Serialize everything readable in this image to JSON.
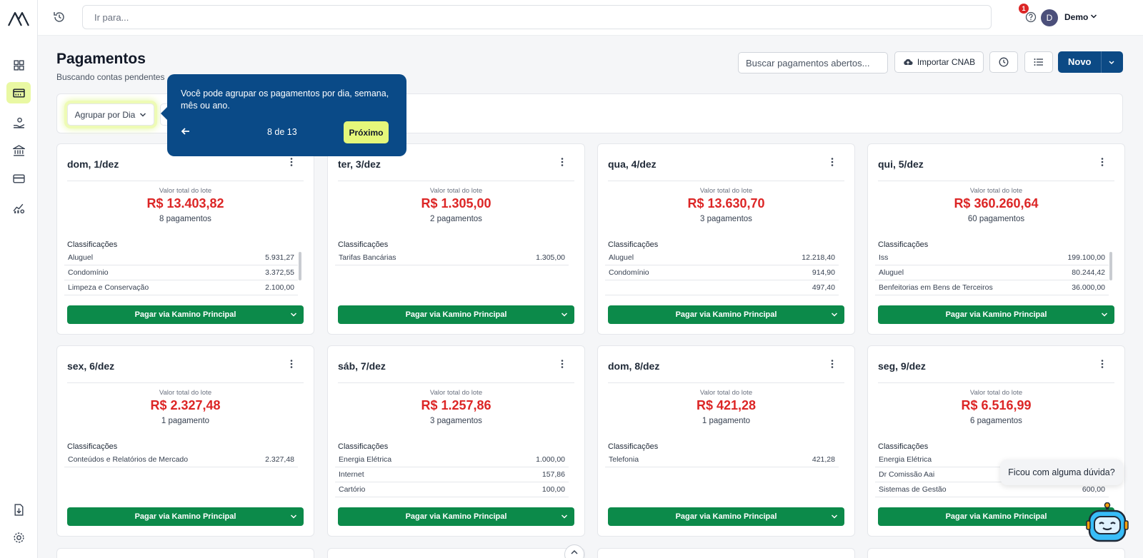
{
  "topbar": {
    "search_placeholder": "Ir para...",
    "notification_count": "1",
    "user_initial": "D",
    "user_name": "Demo"
  },
  "sidebar": {
    "items": [
      "dashboard",
      "payments",
      "receivables",
      "bank",
      "cards",
      "reports",
      "import",
      "settings"
    ],
    "active": "payments",
    "accent_color": "#e9f8a3"
  },
  "header": {
    "title": "Pagamentos",
    "subtitle": "Buscando contas pendentes c",
    "search_placeholder": "Buscar pagamentos abertos...",
    "import_label": "Importar CNAB",
    "new_label": "Novo"
  },
  "filters": {
    "group_label": "Agrupar por Dia"
  },
  "tour": {
    "text": "Você pode agrupar os pagamentos por dia, semana, mês ou ano.",
    "counter": "8 de 13",
    "next_label": "Próximo"
  },
  "card_labels": {
    "total_label": "Valor total do lote",
    "class_title": "Classificações",
    "pay_label": "Pagar via Kamino Principal"
  },
  "cards": [
    {
      "date": "dom, 1/dez",
      "total": "R$ 13.403,82",
      "count": "8 pagamentos",
      "rows": [
        {
          "name": "Aluguel",
          "value": "5.931,27"
        },
        {
          "name": "Condomínio",
          "value": "3.372,55"
        },
        {
          "name": "Limpeza e Conservação",
          "value": "2.100,00"
        }
      ]
    },
    {
      "date": "ter, 3/dez",
      "total": "R$ 1.305,00",
      "count": "2 pagamentos",
      "rows": [
        {
          "name": "Tarifas Bancárias",
          "value": "1.305,00"
        }
      ]
    },
    {
      "date": "qua, 4/dez",
      "total": "R$ 13.630,70",
      "count": "3 pagamentos",
      "rows": [
        {
          "name": "Aluguel",
          "value": "12.218,40"
        },
        {
          "name": "Condomínio",
          "value": "914,90"
        },
        {
          "name": "",
          "value": "497,40"
        }
      ]
    },
    {
      "date": "qui, 5/dez",
      "total": "R$ 360.260,64",
      "count": "60 pagamentos",
      "rows": [
        {
          "name": "Iss",
          "value": "199.100,00"
        },
        {
          "name": "Aluguel",
          "value": "80.244,42"
        },
        {
          "name": "Benfeitorias em Bens de Terceiros",
          "value": "36.000,00"
        }
      ]
    },
    {
      "date": "sex, 6/dez",
      "total": "R$ 2.327,48",
      "count": "1 pagamento",
      "rows": [
        {
          "name": "Conteúdos e Relatórios de Mercado",
          "value": "2.327,48"
        }
      ]
    },
    {
      "date": "sáb, 7/dez",
      "total": "R$ 1.257,86",
      "count": "3 pagamentos",
      "rows": [
        {
          "name": "Energia Elétrica",
          "value": "1.000,00"
        },
        {
          "name": "Internet",
          "value": "157,86"
        },
        {
          "name": "Cartório",
          "value": "100,00"
        }
      ]
    },
    {
      "date": "dom, 8/dez",
      "total": "R$ 421,28",
      "count": "1 pagamento",
      "rows": [
        {
          "name": "Telefonia",
          "value": "421,28"
        }
      ]
    },
    {
      "date": "seg, 9/dez",
      "total": "R$ 6.516,99",
      "count": "6 pagamentos",
      "rows": [
        {
          "name": "Energia Elétrica",
          "value": ""
        },
        {
          "name": "Dr Comissão Aai",
          "value": ""
        },
        {
          "name": "Sistemas de Gestão",
          "value": "600,00"
        }
      ]
    }
  ],
  "help": {
    "bubble_text": "Ficou com alguma dúvida?"
  },
  "colors": {
    "primary": "#0c4a85",
    "pay_green": "#0c8a4a",
    "total_red": "#dc2626",
    "tour_next": "#e5f77a"
  }
}
